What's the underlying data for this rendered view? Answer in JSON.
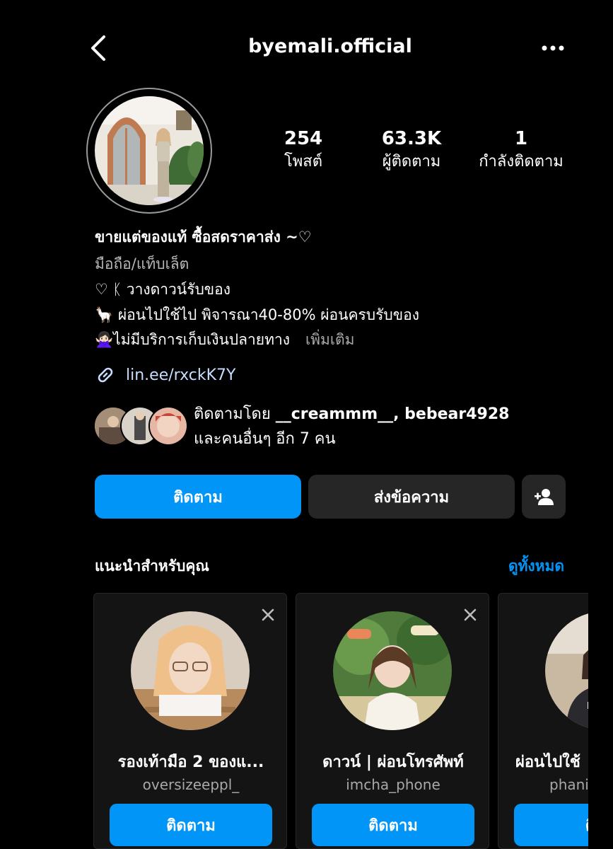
{
  "header": {
    "username": "byemali.official"
  },
  "stats": [
    {
      "value": "254",
      "label": "โพสต์"
    },
    {
      "value": "63.3K",
      "label": "ผู้ติดตาม"
    },
    {
      "value": "1",
      "label": "กำลังติดตาม"
    }
  ],
  "bio": {
    "name": "ขายแต่ของแท้ ซื้อสดราคาส่ง ~♡",
    "category": "มือถือ/แท็บเล็ต",
    "line1": "♡ ᛕ วางดาวน์รับของ",
    "line2": "🦙 ผ่อนไปใช้ไป พิจารณา40-80% ผ่อนครบรับของ",
    "line3": "🙅🏻‍♀️ไม่มีบริการเก็บเงินปลายทาง",
    "more": "เพิ่มเติม",
    "link": "lin.ee/rxckK7Y"
  },
  "followed_by": {
    "prefix": "ติดตามโดย",
    "users": "__creammm__, bebear4928",
    "others": "และคนอื่นๆ อีก 7 คน"
  },
  "actions": {
    "follow": "ติดตาม",
    "message": "ส่งข้อความ"
  },
  "suggestions": {
    "title": "แนะนำสำหรับคุณ",
    "see_all": "ดูทั้งหมด",
    "cards": [
      {
        "name": "รองเท้ามือ 2 ของแ...",
        "username": "oversizeeppl_",
        "button": "ติดตาม"
      },
      {
        "name": "ดาวน์ | ผ่อนโทรศัพท์",
        "username": "imcha_phone",
        "button": "ติดตาม"
      },
      {
        "name": "ผ่อนไปใช้",
        "username": "phani",
        "button": "ติด"
      }
    ]
  },
  "colors": {
    "accent": "#0095f6",
    "secondary_button": "#262626",
    "link": "#c6ddff"
  }
}
